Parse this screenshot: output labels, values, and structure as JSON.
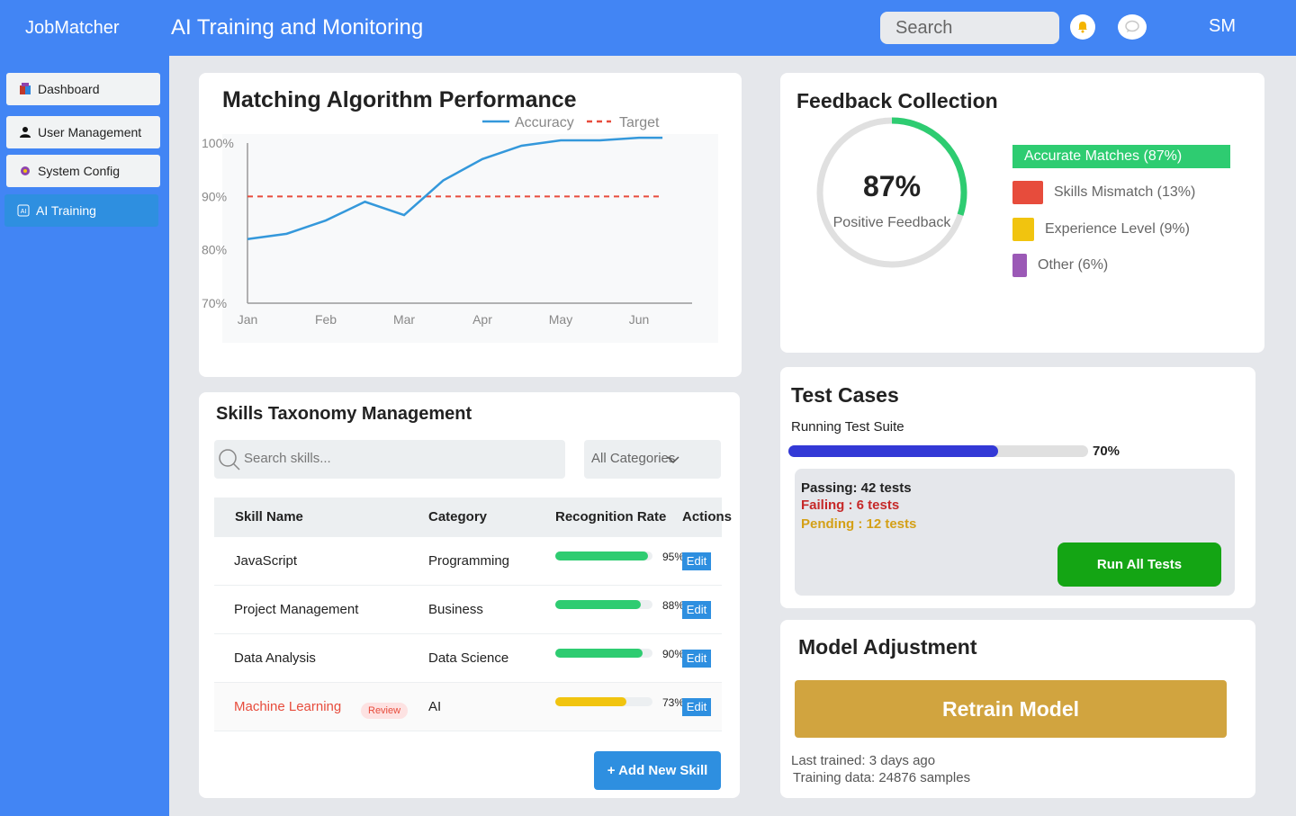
{
  "header": {
    "brand": "JobMatcher",
    "title": "AI Training and Monitoring",
    "search_placeholder": "Search",
    "user_initials": "SM"
  },
  "sidebar": {
    "items": [
      {
        "label": "Dashboard",
        "icon": "dashboard-icon"
      },
      {
        "label": "User Management",
        "icon": "user-icon"
      },
      {
        "label": "System Config",
        "icon": "gear-icon"
      },
      {
        "label": "AI Training",
        "icon": "ai-icon",
        "active": true
      }
    ]
  },
  "performance": {
    "title": "Matching Algorithm Performance",
    "legend_accuracy": "Accuracy",
    "legend_target": "Target",
    "chart_data": {
      "type": "line",
      "categories": [
        "Jan",
        "Feb",
        "Mar",
        "Apr",
        "May",
        "Jun"
      ],
      "series": [
        {
          "name": "Accuracy",
          "x": [
            0,
            0.5,
            1,
            1.5,
            2,
            2.5,
            3,
            3.5,
            4,
            4.5,
            5,
            5.3
          ],
          "values": [
            82,
            83,
            85.5,
            89,
            86.5,
            93,
            97,
            99.5,
            100.5,
            100.5,
            101,
            101
          ]
        },
        {
          "name": "Target",
          "values": [
            90,
            90,
            90,
            90,
            90,
            90
          ]
        }
      ],
      "ytick_labels": [
        "100%",
        "90%",
        "80%",
        "70%"
      ],
      "ylim": [
        70,
        100
      ],
      "colors": {
        "Accuracy": "#3498db",
        "Target": "#e74c3c"
      }
    }
  },
  "feedback": {
    "title": "Feedback Collection",
    "percent": "87%",
    "percent_value": 87,
    "label": "Positive Feedback",
    "legend": [
      {
        "label": "Accurate Matches (87%)",
        "color": "#2ecc71"
      },
      {
        "label": "Skills Mismatch (13%)",
        "color": "#e74c3c"
      },
      {
        "label": "Experience Level (9%)",
        "color": "#f1c40f"
      },
      {
        "label": "Other (6%)",
        "color": "#9b59b6"
      }
    ]
  },
  "skills": {
    "title": "Skills Taxonomy Management",
    "search_placeholder": "Search skills...",
    "category_filter": "All Categories",
    "columns": [
      "Skill Name",
      "Category",
      "Recognition Rate",
      "Actions"
    ],
    "rows": [
      {
        "name": "JavaScript",
        "category": "Programming",
        "rate": 95,
        "rate_label": "95%",
        "color": "#2ecc71",
        "action": "Edit"
      },
      {
        "name": "Project Management",
        "category": "Business",
        "rate": 88,
        "rate_label": "88%",
        "color": "#2ecc71",
        "action": "Edit"
      },
      {
        "name": "Data Analysis",
        "category": "Data Science",
        "rate": 90,
        "rate_label": "90%",
        "color": "#2ecc71",
        "action": "Edit"
      },
      {
        "name": "Machine Learning",
        "category": "AI",
        "rate": 73,
        "rate_label": "73%",
        "color": "#f1c40f",
        "action": "Edit",
        "badge": "Review"
      }
    ],
    "add_button": "+ Add New Skill"
  },
  "tests": {
    "title": "Test Cases",
    "running_label": "Running Test Suite",
    "progress": 70,
    "progress_label": "70%",
    "passing": "Passing: 42 tests",
    "failing": "Failing : 6 tests",
    "pending": "Pending : 12 tests",
    "run_button": "Run All Tests"
  },
  "model": {
    "title": "Model Adjustment",
    "retrain_button": "Retrain Model",
    "last_trained": "Last trained: 3 days ago",
    "training_data": "Training data: 24876 samples"
  }
}
